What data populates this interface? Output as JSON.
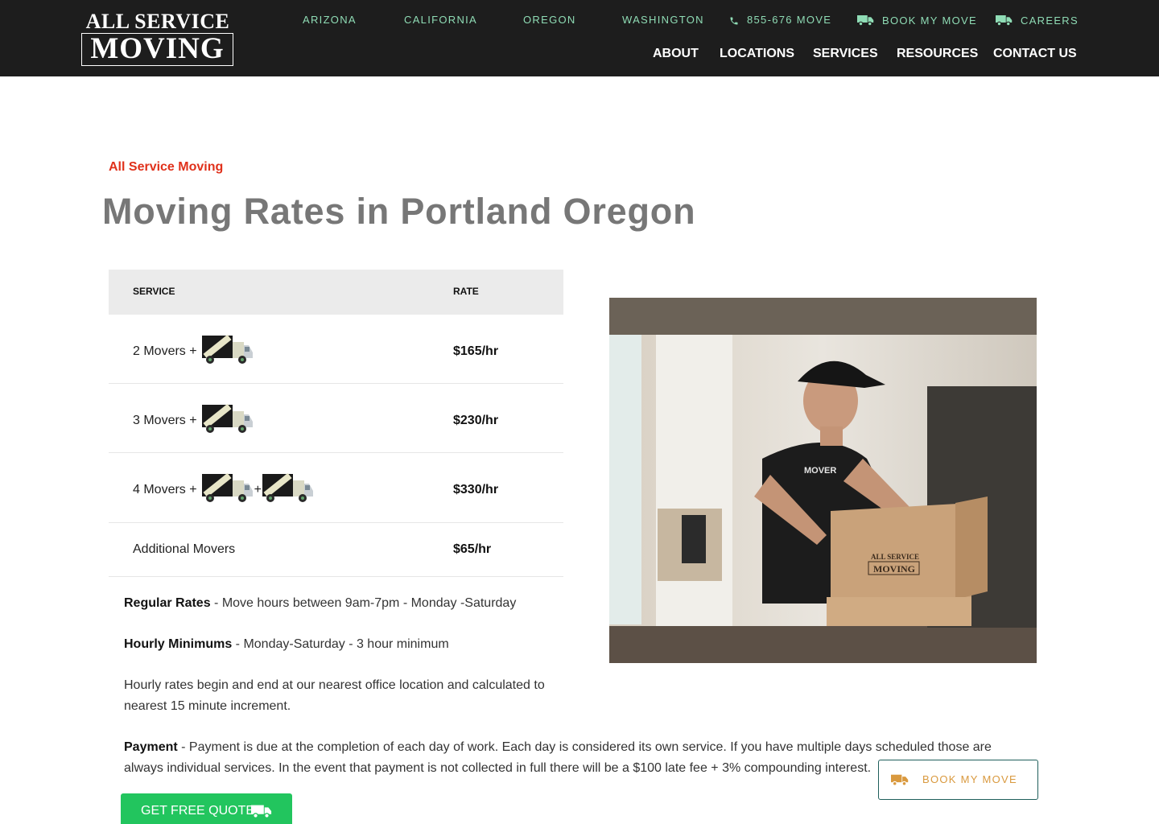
{
  "header": {
    "logo_top": "ALL SERVICE",
    "logo_bottom": "MOVING",
    "top_links": {
      "arizona": "ARIZONA",
      "california": "CALIFORNIA",
      "oregon": "OREGON",
      "washington": "WASHINGTON",
      "phone": "855-676 MOVE",
      "book": "BOOK MY MOVE",
      "careers": "CAREERS"
    },
    "main_nav": {
      "about": "ABOUT",
      "locations": "LOCATIONS",
      "services": "SERVICES",
      "resources": "RESOURCES",
      "contact": "CONTACT US"
    }
  },
  "main": {
    "eyebrow": "All Service Moving",
    "title": "Moving Rates in Portland Oregon",
    "table": {
      "col_service": "SERVICE",
      "col_rate": "RATE",
      "rows": [
        {
          "service": "2 Movers +",
          "rate": "$165/hr"
        },
        {
          "service": "3 Movers +",
          "rate": "$230/hr"
        },
        {
          "service": "4 Movers +",
          "plus": "+",
          "rate": "$330/hr"
        },
        {
          "service": "Additional Movers",
          "rate": "$65/hr"
        }
      ]
    },
    "regular": {
      "label": "Regular Rates",
      "text": " - Move hours between 9am-7pm - Monday -Saturday"
    },
    "minimums": {
      "label": "Hourly Minimums",
      "text": " - Monday-Saturday - 3 hour minimum"
    },
    "hourly_note": "Hourly rates begin and end at our nearest office location and calculated to nearest 15 minute increment.",
    "payment": {
      "label": "Payment",
      "text": " - Payment is due at the completion of each day of work. Each day is considered its own service. If you have multiple days scheduled those are always individual services. In the event that payment is not collected in full there will be a $100 late fee + 3% compounding interest."
    },
    "quote_button": "GET FREE QUOTE",
    "photo": {
      "shirt_text": "MOVER",
      "box_line1": "ALL SERVICE",
      "box_line2": "MOVING"
    }
  },
  "floating": {
    "book_button": "BOOK MY MOVE"
  },
  "colors": {
    "header_bg": "#1d1d1d",
    "top_link": "#8fdcb5",
    "accent_red": "#e0311b",
    "quote_green": "#22c55e",
    "book_orange": "#d9993e"
  }
}
